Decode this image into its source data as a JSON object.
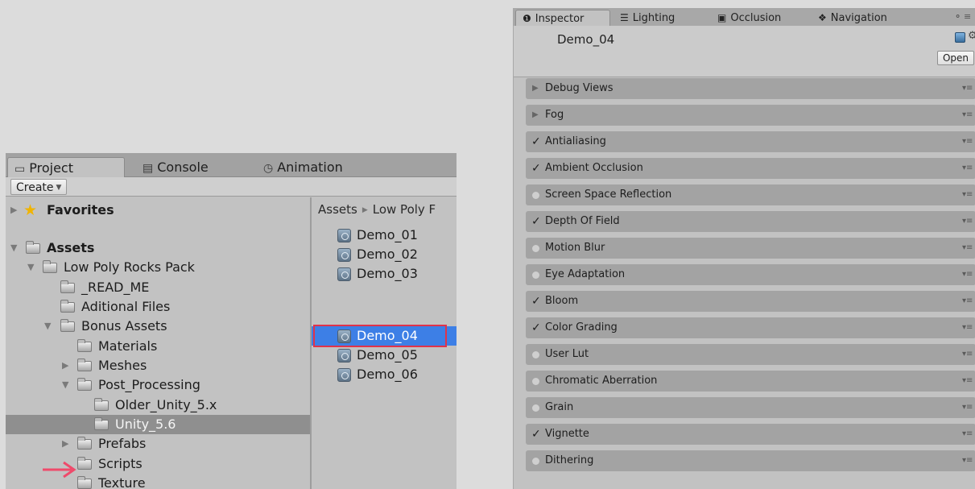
{
  "project": {
    "tabs": [
      {
        "label": "Project",
        "icon": "folder-icon"
      },
      {
        "label": "Console",
        "icon": "console-icon"
      },
      {
        "label": "Animation",
        "icon": "clock-icon"
      }
    ],
    "create_label": "Create",
    "tree": {
      "favorites": "Favorites",
      "assets": "Assets",
      "items": [
        {
          "label": "Low Poly Rocks Pack"
        },
        {
          "label": "_READ_ME"
        },
        {
          "label": "Aditional Files"
        },
        {
          "label": "Bonus Assets"
        },
        {
          "label": "Materials"
        },
        {
          "label": "Meshes"
        },
        {
          "label": "Post_Processing"
        },
        {
          "label": "Older_Unity_5.x"
        },
        {
          "label": "Unity_5.6",
          "selected": true
        },
        {
          "label": "Prefabs"
        },
        {
          "label": "Scripts"
        },
        {
          "label": "Texture"
        }
      ]
    },
    "breadcrumb": [
      "Assets",
      "Low Poly F"
    ],
    "files": [
      {
        "label": "Demo_01"
      },
      {
        "label": "Demo_02"
      },
      {
        "label": "Demo_03"
      },
      {
        "label": "Demo_04",
        "selected": true
      },
      {
        "label": "Demo_05"
      },
      {
        "label": "Demo_06"
      }
    ]
  },
  "inspector": {
    "tabs": [
      {
        "label": "Inspector",
        "icon": "info-icon"
      },
      {
        "label": "Lighting",
        "icon": "lighting-icon"
      },
      {
        "label": "Occlusion",
        "icon": "occlusion-icon"
      },
      {
        "label": "Navigation",
        "icon": "navigation-icon"
      }
    ],
    "asset_name": "Demo_04",
    "open_label": "Open",
    "effects": [
      {
        "label": "Debug Views",
        "state": "foldout"
      },
      {
        "label": "Fog",
        "state": "foldout"
      },
      {
        "label": "Antialiasing",
        "state": "enabled"
      },
      {
        "label": "Ambient Occlusion",
        "state": "enabled"
      },
      {
        "label": "Screen Space Reflection",
        "state": "disabled"
      },
      {
        "label": "Depth Of Field",
        "state": "enabled"
      },
      {
        "label": "Motion Blur",
        "state": "disabled"
      },
      {
        "label": "Eye Adaptation",
        "state": "disabled"
      },
      {
        "label": "Bloom",
        "state": "enabled"
      },
      {
        "label": "Color Grading",
        "state": "enabled"
      },
      {
        "label": "User Lut",
        "state": "disabled"
      },
      {
        "label": "Chromatic Aberration",
        "state": "disabled"
      },
      {
        "label": "Grain",
        "state": "disabled"
      },
      {
        "label": "Vignette",
        "state": "enabled"
      },
      {
        "label": "Dithering",
        "state": "disabled"
      }
    ]
  },
  "colors": {
    "selection_blue": "#3d7fe6",
    "highlight_red": "#e0334a",
    "arrow_pink": "#ef4a6b",
    "panel_gray": "#c2c2c2"
  }
}
